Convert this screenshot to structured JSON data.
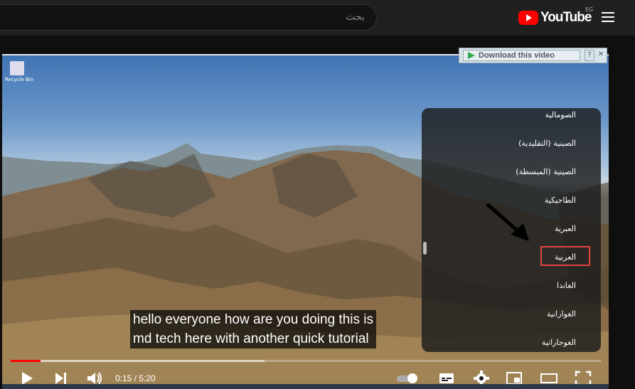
{
  "masthead": {
    "search_placeholder": "بحث",
    "logo_text": "YouTube",
    "country_code": "EG"
  },
  "player": {
    "download_button": "Download this video",
    "download_help": "?",
    "download_close": "✕",
    "desktop_icon_label": "Recycle Bin",
    "subtitle_lines": [
      "hello everyone how are you doing this is",
      "md tech here with another quick tutorial"
    ],
    "time_current": "0:15",
    "time_separator": " / ",
    "time_total": "5:20",
    "progress_played_pct": 5,
    "progress_loaded_pct": 43
  },
  "language_menu": {
    "items": [
      "الصومالية",
      "الصينية (التقليدية)",
      "الصينية (المبسطة)",
      "الطاجيكية",
      "العبرية",
      "العربية",
      "الغاندا",
      "الغوارانية",
      "الغوجاراتية"
    ],
    "highlighted": "العربية"
  },
  "colors": {
    "accent": "#ff0000",
    "highlight_border": "#e0473f"
  }
}
